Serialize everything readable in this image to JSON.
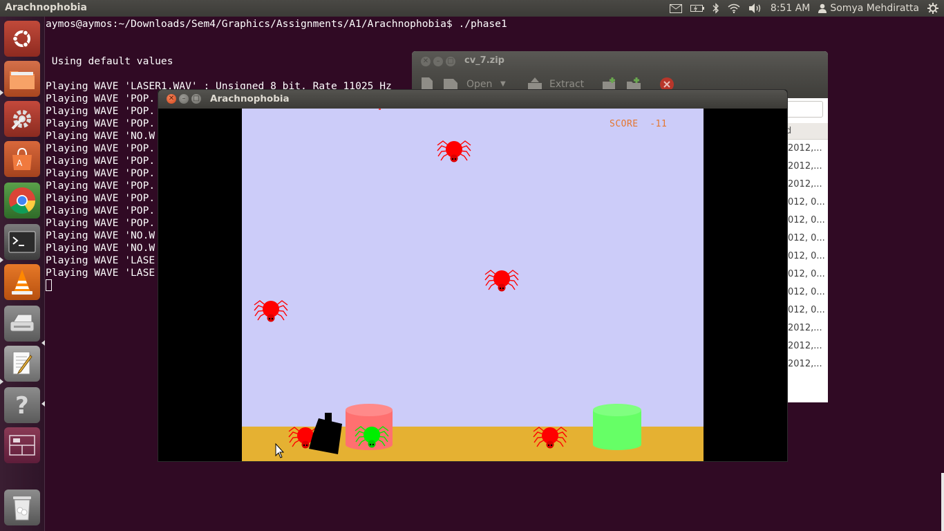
{
  "top_panel": {
    "app_title": "Arachnophobia",
    "time": "8:51 AM",
    "user": "Somya Mehdiratta",
    "icons": [
      "mail-icon",
      "battery-icon",
      "bluetooth-icon",
      "wifi-icon",
      "volume-icon",
      "clock",
      "user-icon",
      "power-gear-icon"
    ]
  },
  "launcher": {
    "items": [
      "ubuntu-dash",
      "home-folder",
      "system-settings",
      "ubuntu-software-center",
      "chromium-browser",
      "terminal",
      "vlc-media-player",
      "scanner",
      "text-editor",
      "help",
      "workspace-switcher",
      "trash"
    ]
  },
  "terminal": {
    "prompt": "aymos@aymos:~/Downloads/Sem4/Graphics/Assignments/A1/Arachnophobia$ ./phase1",
    "lines": [
      " Using default values",
      "Playing WAVE 'LASER1.WAV' : Unsigned 8 bit, Rate 11025 Hz",
      "Playing WAVE 'POP.",
      "Playing WAVE 'POP.",
      "Playing WAVE 'POP.",
      "Playing WAVE 'NO.W",
      "Playing WAVE 'POP.",
      "Playing WAVE 'POP.",
      "Playing WAVE 'POP.",
      "Playing WAVE 'POP.",
      "Playing WAVE 'POP.",
      "Playing WAVE 'POP.",
      "Playing WAVE 'POP.",
      "Playing WAVE 'NO.W",
      "Playing WAVE 'NO.W",
      "Playing WAVE 'LASE",
      "Playing WAVE 'LASE"
    ]
  },
  "archive_window": {
    "title": "cv_7.zip",
    "toolbar": {
      "open": "Open",
      "extract": "Extract"
    },
    "column_header": "d",
    "date_cells": [
      "2012,...",
      "2012,...",
      "2012,...",
      "012, 0...",
      "012, 0...",
      "012, 0...",
      "012, 0...",
      "012, 0...",
      "012, 0...",
      "012, 0...",
      "2012,...",
      "2012,...",
      "2012,..."
    ]
  },
  "game_window": {
    "title": "Arachnophobia",
    "score_label": "SCORE",
    "score_value": "-11"
  },
  "colors": {
    "desktop": "#300a24",
    "game_sky": "#ccccf9",
    "game_ground": "#e5b132",
    "spider_red": "#ff0000",
    "spider_green": "#00ee00",
    "basket_red": "#ff7070",
    "basket_green": "#66ff66",
    "score": "#e5762e"
  }
}
